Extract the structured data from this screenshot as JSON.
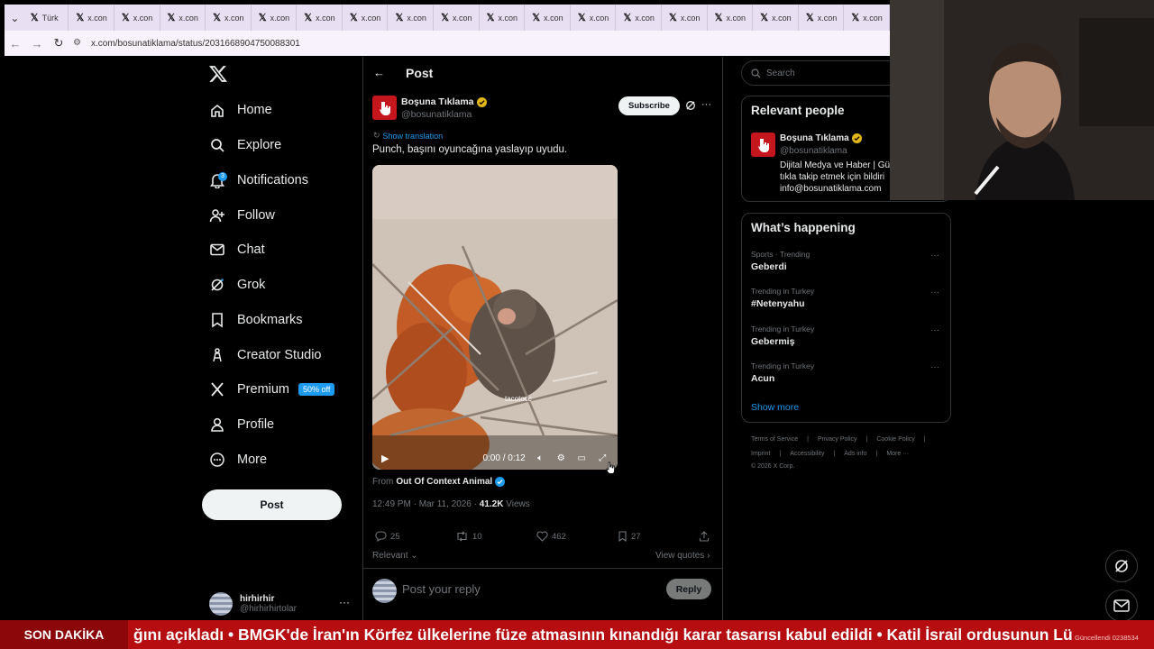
{
  "browser": {
    "tabs": [
      {
        "label": "Türk"
      },
      {
        "label": "x.con"
      },
      {
        "label": "x.con"
      },
      {
        "label": "x.con"
      },
      {
        "label": "x.con"
      },
      {
        "label": "x.con"
      },
      {
        "label": "x.con"
      },
      {
        "label": "x.con"
      },
      {
        "label": "x.con"
      },
      {
        "label": "x.con"
      },
      {
        "label": "x.con"
      },
      {
        "label": "x.con"
      },
      {
        "label": "x.con"
      },
      {
        "label": "x.con"
      },
      {
        "label": "x.con"
      },
      {
        "label": "x.con"
      },
      {
        "label": "x.con"
      },
      {
        "label": "x.con"
      },
      {
        "label": "x.con"
      }
    ],
    "url": "x.com/bosunatiklama/status/2031668904750088301"
  },
  "nav": {
    "items": [
      {
        "label": "Home",
        "icon": "home-icon"
      },
      {
        "label": "Explore",
        "icon": "search-icon"
      },
      {
        "label": "Notifications",
        "icon": "bell-icon",
        "badge": "3"
      },
      {
        "label": "Follow",
        "icon": "add-person-icon"
      },
      {
        "label": "Chat",
        "icon": "mail-icon"
      },
      {
        "label": "Grok",
        "icon": "grok-icon"
      },
      {
        "label": "Bookmarks",
        "icon": "bookmark-icon"
      },
      {
        "label": "Creator Studio",
        "icon": "creator-icon"
      },
      {
        "label": "Premium",
        "icon": "x-icon",
        "badge": "50% off"
      },
      {
        "label": "Profile",
        "icon": "person-icon"
      },
      {
        "label": "More",
        "icon": "more-circle-icon"
      }
    ],
    "post_button": "Post",
    "account": {
      "name": "hirhirhir",
      "handle": "@hirhirhirtolar"
    }
  },
  "post": {
    "header_title": "Post",
    "author_name": "Boşuna Tıklama",
    "author_handle": "@bosunatiklama",
    "subscribe_label": "Subscribe",
    "show_translation": "Show translation",
    "text": "Punch, başını oyuncağına yaslayıp uyudu.",
    "video": {
      "watermark": "tacotocc",
      "time": "0:00 / 0:12"
    },
    "from_prefix": "From",
    "from_source": "Out Of Context Animal",
    "timestamp": "12:49 PM · Mar 11, 2026 · ",
    "views_count": "41.2K",
    "views_label": " Views",
    "stats": {
      "replies": "25",
      "reposts": "10",
      "likes": "462",
      "bookmarks": "27"
    },
    "sort_label": "Relevant",
    "view_quotes": "View quotes",
    "reply_placeholder": "Post your reply",
    "reply_button": "Reply"
  },
  "sidebar": {
    "search_placeholder": "Search",
    "relevant_title": "Relevant people",
    "relevant_person": {
      "name": "Boşuna Tıklama",
      "handle": "@bosunatiklama",
      "bio": "Dijital Medya ve Haber | Gü tıkla takip etmek için bildiri info@bosunatiklama.com"
    },
    "happening_title": "What’s happening",
    "trends": [
      {
        "context": "Sports · Trending",
        "name": "Geberdi"
      },
      {
        "context": "Trending in Turkey",
        "name": "#Netenyahu"
      },
      {
        "context": "Trending in Turkey",
        "name": "Gebermiş"
      },
      {
        "context": "Trending in Turkey",
        "name": "Acun"
      }
    ],
    "show_more": "Show more",
    "footer_row1": [
      "Terms of Service",
      "|",
      "Privacy Policy",
      "|",
      "Cookie Policy",
      "|"
    ],
    "footer_row2": [
      "Imprint",
      "|",
      "Accessibility",
      "|",
      "Ads info",
      "|",
      "More ···"
    ],
    "footer_copyright": "© 2026 X Corp."
  },
  "ticker": {
    "label": "SON DAKİKA",
    "text": "ğını açıkladı  •  BMGK'de İran'ın Körfez ülkelerine füze atmasının kınandığı karar tasarısı kabul edildi  •  Katil İsrail ordusunun Lü",
    "stamp": "Güncellendi 0238534"
  },
  "colors": {
    "accent": "#1d9bf0",
    "ticker_red": "#b50d10",
    "verified_gold": "#e2b719",
    "brand_red": "#c4161c"
  }
}
